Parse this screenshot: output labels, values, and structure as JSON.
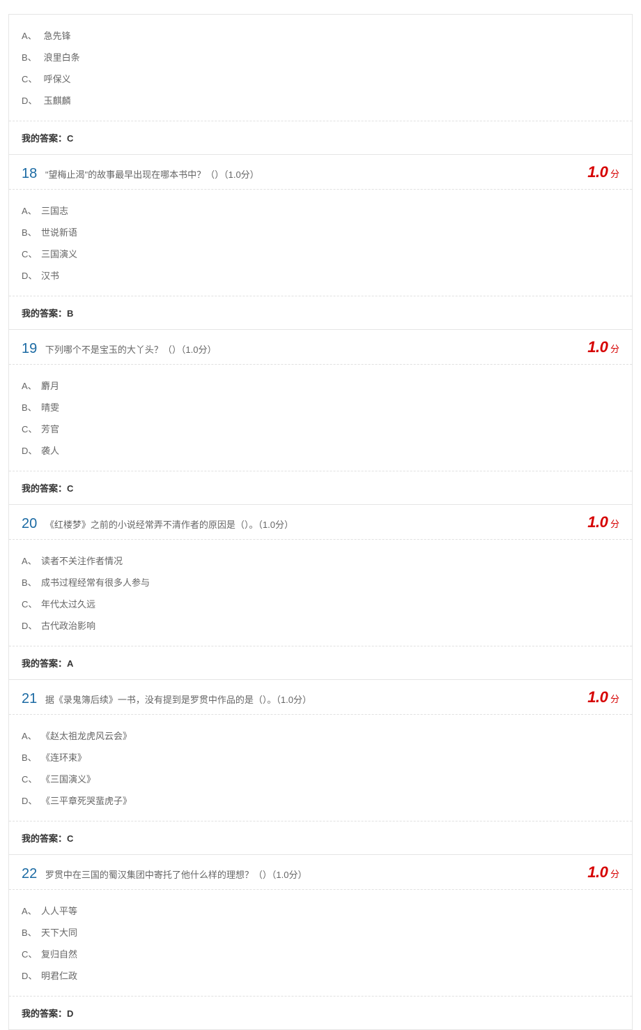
{
  "answer_label": "我的答案：",
  "score_suffix": "分",
  "question_partial": {
    "options": [
      {
        "letter": "A、",
        "text": "急先锋"
      },
      {
        "letter": "B、",
        "text": "浪里白条"
      },
      {
        "letter": "C、",
        "text": "呼保义"
      },
      {
        "letter": "D、",
        "text": "玉麒麟"
      }
    ],
    "my_answer": "C"
  },
  "questions": [
    {
      "num": "18",
      "text": "\"望梅止渴\"的故事最早出现在哪本书中？（）（1.0分）",
      "score": "1.0",
      "options": [
        {
          "letter": "A、",
          "text": "三国志"
        },
        {
          "letter": "B、",
          "text": "世说新语"
        },
        {
          "letter": "C、",
          "text": "三国演义"
        },
        {
          "letter": "D、",
          "text": "汉书"
        }
      ],
      "my_answer": "B"
    },
    {
      "num": "19",
      "text": "下列哪个不是宝玉的大丫头？（）（1.0分）",
      "score": "1.0",
      "options": [
        {
          "letter": "A、",
          "text": "麝月"
        },
        {
          "letter": "B、",
          "text": "晴雯"
        },
        {
          "letter": "C、",
          "text": "芳官"
        },
        {
          "letter": "D、",
          "text": "袭人"
        }
      ],
      "my_answer": "C"
    },
    {
      "num": "20",
      "text": "《红楼梦》之前的小说经常弄不清作者的原因是（）。（1.0分）",
      "score": "1.0",
      "options": [
        {
          "letter": "A、",
          "text": "读者不关注作者情况"
        },
        {
          "letter": "B、",
          "text": "成书过程经常有很多人参与"
        },
        {
          "letter": "C、",
          "text": "年代太过久远"
        },
        {
          "letter": "D、",
          "text": "古代政治影响"
        }
      ],
      "my_answer": "A"
    },
    {
      "num": "21",
      "text": "据《录鬼簿后续》一书，没有提到是罗贯中作品的是（）。（1.0分）",
      "score": "1.0",
      "options": [
        {
          "letter": "A、",
          "text": "《赵太祖龙虎风云会》"
        },
        {
          "letter": "B、",
          "text": "《连环束》"
        },
        {
          "letter": "C、",
          "text": "《三国演义》"
        },
        {
          "letter": "D、",
          "text": "《三平章死哭蜚虎子》"
        }
      ],
      "my_answer": "C"
    },
    {
      "num": "22",
      "text": "罗贯中在三国的蜀汉集团中寄托了他什么样的理想？（）（1.0分）",
      "score": "1.0",
      "options": [
        {
          "letter": "A、",
          "text": "人人平等"
        },
        {
          "letter": "B、",
          "text": "天下大同"
        },
        {
          "letter": "C、",
          "text": "复归自然"
        },
        {
          "letter": "D、",
          "text": "明君仁政"
        }
      ],
      "my_answer": "D"
    }
  ]
}
